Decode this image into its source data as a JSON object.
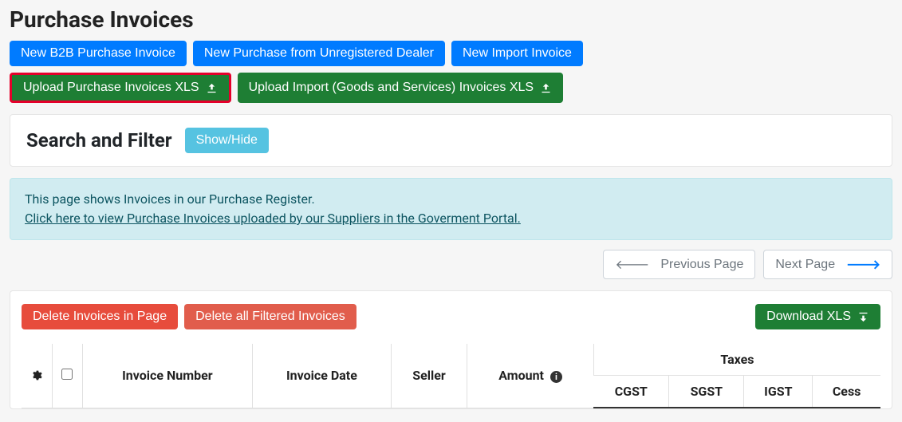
{
  "page": {
    "title": "Purchase Invoices"
  },
  "actions_row1": {
    "new_b2b": "New B2B Purchase Invoice",
    "new_unreg": "New Purchase from Unregistered Dealer",
    "new_import": "New Import Invoice"
  },
  "actions_row2": {
    "upload_purchase": "Upload Purchase Invoices XLS",
    "upload_import": "Upload Import (Goods and Services) Invoices XLS"
  },
  "filter_card": {
    "heading": "Search and Filter",
    "toggle": "Show/Hide"
  },
  "info": {
    "line1": "This page shows Invoices in our Purchase Register.",
    "link": "Click here to view Purchase Invoices uploaded by our Suppliers in the Goverment Portal."
  },
  "pagination": {
    "prev": "Previous Page",
    "next": "Next Page"
  },
  "table_actions": {
    "delete_page": "Delete Invoices in Page",
    "delete_filtered": "Delete all Filtered Invoices",
    "download": "Download XLS"
  },
  "table": {
    "headers": {
      "invoice_number": "Invoice Number",
      "invoice_date": "Invoice Date",
      "seller": "Seller",
      "amount": "Amount",
      "taxes": "Taxes",
      "cgst": "CGST",
      "sgst": "SGST",
      "igst": "IGST",
      "cess": "Cess"
    },
    "rows": []
  }
}
